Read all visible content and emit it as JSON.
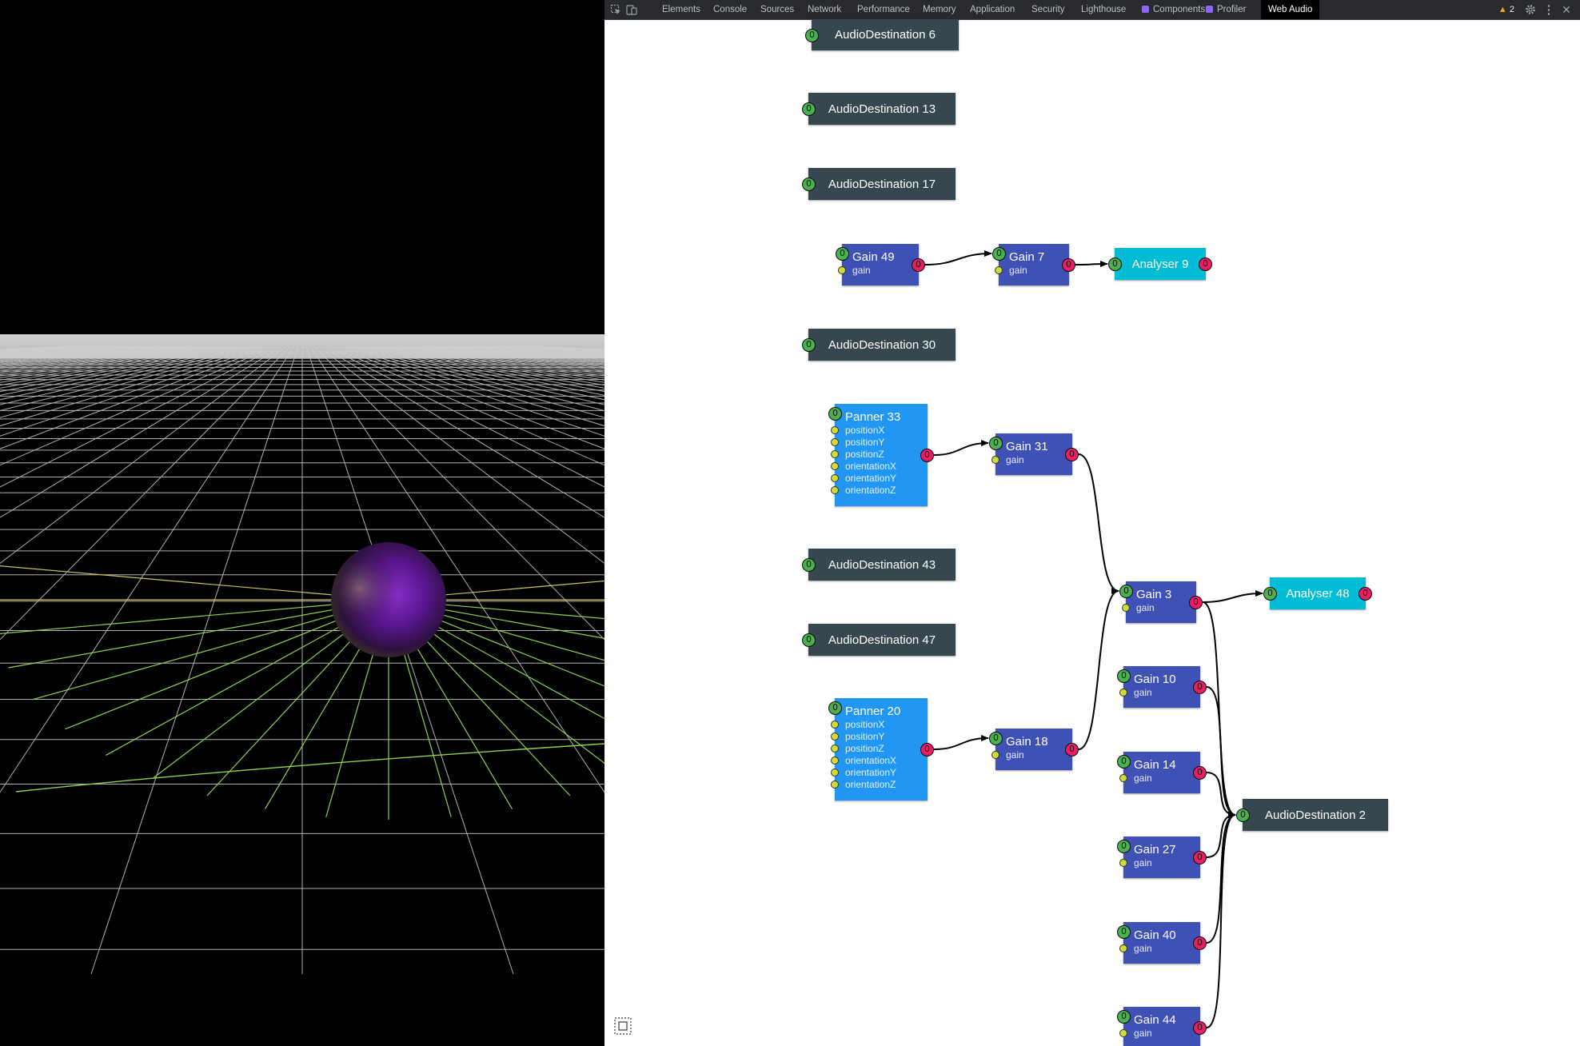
{
  "colors": {
    "dest": "#37474f",
    "gain": "#3f51b5",
    "analyser": "#00bcd4",
    "panner": "#2196f3",
    "input_port": "#4caf50",
    "output_port": "#e91e63",
    "param_port": "#cddc39"
  },
  "toolbar": {
    "tabs": [
      {
        "label": "Elements"
      },
      {
        "label": "Console"
      },
      {
        "label": "Sources"
      },
      {
        "label": "Network"
      },
      {
        "label": "Performance"
      },
      {
        "label": "Memory"
      },
      {
        "label": "Application"
      },
      {
        "label": "Security"
      },
      {
        "label": "Lighthouse"
      },
      {
        "label": "Components",
        "icon": "react-extension-icon"
      },
      {
        "label": "Profiler",
        "icon": "react-extension-icon"
      },
      {
        "label": "Web Audio",
        "active": true
      }
    ],
    "warning_count": "2",
    "icons": [
      "inspect-element-icon",
      "device-toolbar-icon",
      "warning-icon",
      "settings-gear-icon",
      "more-vertical-icon",
      "close-icon"
    ]
  },
  "graph": {
    "nodes": [
      {
        "id": "dest6",
        "type": "dest",
        "title": "AudioDestination 6",
        "in": "0"
      },
      {
        "id": "dest13",
        "type": "dest",
        "title": "AudioDestination 13",
        "in": "0"
      },
      {
        "id": "dest17",
        "type": "dest",
        "title": "AudioDestination 17",
        "in": "0"
      },
      {
        "id": "gain49",
        "type": "gain",
        "title": "Gain 49",
        "in": "0",
        "out": "0",
        "params": [
          "gain"
        ]
      },
      {
        "id": "gain7",
        "type": "gain",
        "title": "Gain 7",
        "in": "0",
        "out": "0",
        "params": [
          "gain"
        ]
      },
      {
        "id": "analyser9",
        "type": "analyser",
        "title": "Analyser 9",
        "in": "0",
        "out": "0"
      },
      {
        "id": "dest30",
        "type": "dest",
        "title": "AudioDestination 30",
        "in": "0"
      },
      {
        "id": "panner33",
        "type": "panner",
        "title": "Panner 33",
        "in": "0",
        "out": "0",
        "params": [
          "positionX",
          "positionY",
          "positionZ",
          "orientationX",
          "orientationY",
          "orientationZ"
        ]
      },
      {
        "id": "gain31",
        "type": "gain",
        "title": "Gain 31",
        "in": "0",
        "out": "0",
        "params": [
          "gain"
        ]
      },
      {
        "id": "dest43",
        "type": "dest",
        "title": "AudioDestination 43",
        "in": "0"
      },
      {
        "id": "gain3",
        "type": "gain",
        "title": "Gain 3",
        "in": "0",
        "out": "0",
        "params": [
          "gain"
        ]
      },
      {
        "id": "analyser48",
        "type": "analyser",
        "title": "Analyser 48",
        "in": "0",
        "out": "0"
      },
      {
        "id": "dest47",
        "type": "dest",
        "title": "AudioDestination 47",
        "in": "0"
      },
      {
        "id": "gain10",
        "type": "gain",
        "title": "Gain 10",
        "in": "0",
        "out": "0",
        "params": [
          "gain"
        ]
      },
      {
        "id": "panner20",
        "type": "panner",
        "title": "Panner 20",
        "in": "0",
        "out": "0",
        "params": [
          "positionX",
          "positionY",
          "positionZ",
          "orientationX",
          "orientationY",
          "orientationZ"
        ]
      },
      {
        "id": "gain18",
        "type": "gain",
        "title": "Gain 18",
        "in": "0",
        "out": "0",
        "params": [
          "gain"
        ]
      },
      {
        "id": "gain14",
        "type": "gain",
        "title": "Gain 14",
        "in": "0",
        "out": "0",
        "params": [
          "gain"
        ]
      },
      {
        "id": "dest2",
        "type": "dest",
        "title": "AudioDestination 2",
        "in": "0"
      },
      {
        "id": "gain27",
        "type": "gain",
        "title": "Gain 27",
        "in": "0",
        "out": "0",
        "params": [
          "gain"
        ]
      },
      {
        "id": "gain40",
        "type": "gain",
        "title": "Gain 40",
        "in": "0",
        "out": "0",
        "params": [
          "gain"
        ]
      },
      {
        "id": "gain44",
        "type": "gain",
        "title": "Gain 44",
        "in": "0",
        "out": "0",
        "params": [
          "gain"
        ]
      }
    ],
    "edges": [
      [
        "gain49",
        "gain7"
      ],
      [
        "gain7",
        "analyser9"
      ],
      [
        "panner33",
        "gain31"
      ],
      [
        "gain31",
        "gain3"
      ],
      [
        "panner20",
        "gain18"
      ],
      [
        "gain18",
        "gain3"
      ],
      [
        "gain3",
        "analyser48"
      ],
      [
        "gain3",
        "dest2"
      ],
      [
        "gain10",
        "dest2"
      ],
      [
        "gain14",
        "dest2"
      ],
      [
        "gain27",
        "dest2"
      ],
      [
        "gain40",
        "dest2"
      ],
      [
        "gain44",
        "dest2"
      ]
    ]
  }
}
